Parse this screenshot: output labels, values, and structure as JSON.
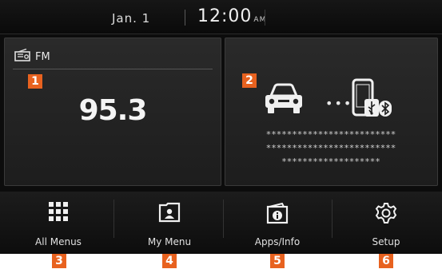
{
  "status": {
    "date": "Jan.  1",
    "time": "12:00",
    "ampm": "AM"
  },
  "radio": {
    "band": "FM",
    "frequency": "95.3"
  },
  "phone": {
    "lines": [
      "*************************",
      "*************************",
      "*******************"
    ]
  },
  "badges": {
    "radio": "1",
    "phone": "2",
    "all_menus": "3",
    "my_menu": "4",
    "apps_info": "5",
    "setup": "6"
  },
  "menu": {
    "all_menus": "All Menus",
    "my_menu": "My Menu",
    "apps_info": "Apps/Info",
    "setup": "Setup"
  },
  "colors": {
    "badge": "#e8621f",
    "background": "#0c0c0c"
  },
  "icons": [
    "radio-icon",
    "car-icon",
    "smartphone-icon",
    "usb-icon",
    "bluetooth-icon",
    "grid-icon",
    "user-folder-icon",
    "info-icon",
    "gear-icon"
  ]
}
